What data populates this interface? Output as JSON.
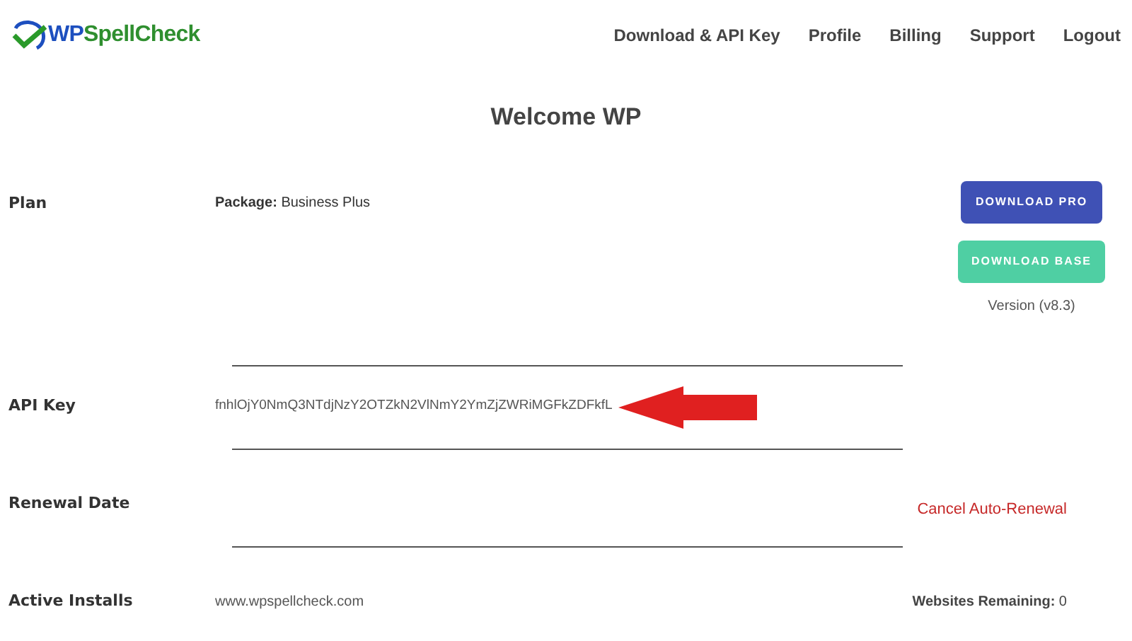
{
  "logo": {
    "prefix": "WP",
    "suffix": "SpellCheck"
  },
  "nav": [
    "Download & API Key",
    "Profile",
    "Billing",
    "Support",
    "Logout"
  ],
  "title": "Welcome WP",
  "plan": {
    "label": "Plan",
    "package": "**Package:** Business Plus",
    "buttons": [
      {
        "label": "DOWNLOAD PRO",
        "kind": "pro"
      },
      {
        "label": "DOWNLOAD BASE",
        "kind": "base"
      }
    ],
    "version": "Version (v8.3)"
  },
  "api_key": {
    "label": "API Key",
    "value": "fnhlOjY0NmQ3NTdjNzY2OTZkN2VlNmY2YmZjZWRiMGFkZDFkfL"
  },
  "renewal": {
    "label": "Renewal Date",
    "action": "Cancel Auto-Renewal"
  },
  "installs": {
    "label": "Active Installs",
    "site": "www.wpspellcheck.com",
    "remaining": "**Websites Remaining:** 0"
  }
}
